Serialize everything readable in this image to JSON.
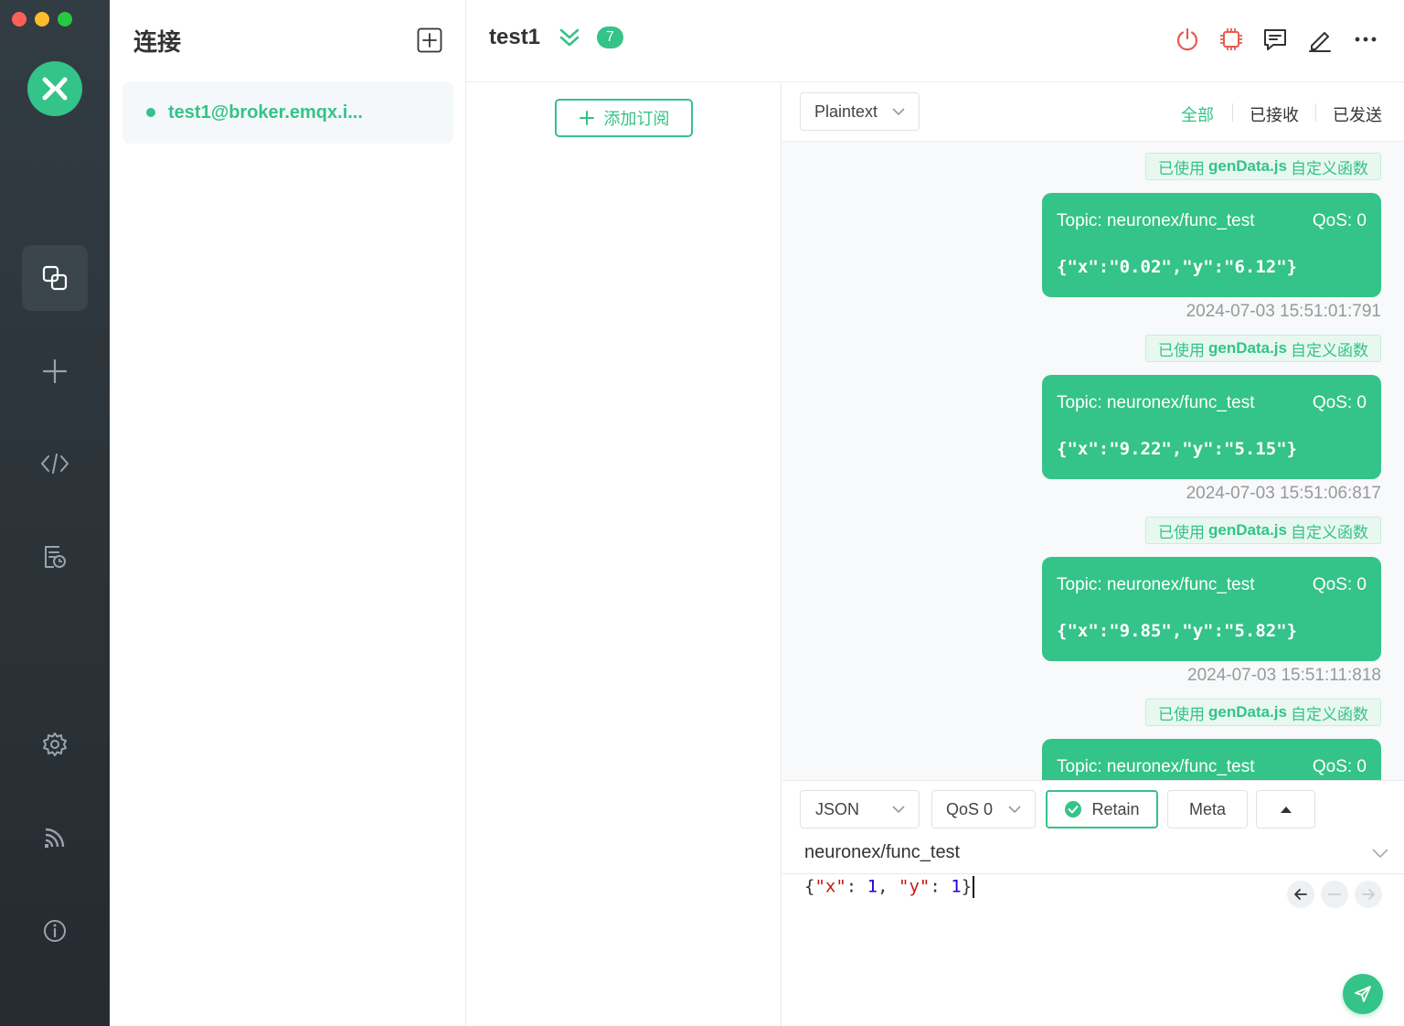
{
  "sidebar": {
    "nav": [
      "connections",
      "new-connection",
      "scripts",
      "logs",
      "settings",
      "subscriptions-feed",
      "about"
    ]
  },
  "connections": {
    "title": "连接",
    "items": [
      {
        "label": "test1@broker.emqx.i...",
        "status": "connected"
      }
    ]
  },
  "header": {
    "connection_name": "test1",
    "unread_count": "7"
  },
  "subscriptions": {
    "add_label": "添加订阅"
  },
  "messages": {
    "format": "Plaintext",
    "filters": [
      "全部",
      "已接收",
      "已发送"
    ],
    "items": [
      {
        "tag_prefix": "已使用",
        "tag_script": "genData.js",
        "tag_suffix": "自定义函数",
        "topic": "Topic: neuronex/func_test",
        "qos": "QoS: 0",
        "payload": "{\"x\":\"0.02\",\"y\":\"6.12\"}",
        "time": "2024-07-03 15:51:01:791"
      },
      {
        "tag_prefix": "已使用",
        "tag_script": "genData.js",
        "tag_suffix": "自定义函数",
        "topic": "Topic: neuronex/func_test",
        "qos": "QoS: 0",
        "payload": "{\"x\":\"9.22\",\"y\":\"5.15\"}",
        "time": "2024-07-03 15:51:06:817"
      },
      {
        "tag_prefix": "已使用",
        "tag_script": "genData.js",
        "tag_suffix": "自定义函数",
        "topic": "Topic: neuronex/func_test",
        "qos": "QoS: 0",
        "payload": "{\"x\":\"9.85\",\"y\":\"5.82\"}",
        "time": "2024-07-03 15:51:11:818"
      },
      {
        "tag_prefix": "已使用",
        "tag_script": "genData.js",
        "tag_suffix": "自定义函数",
        "topic": "Topic: neuronex/func_test",
        "qos": "QoS: 0",
        "payload": "",
        "time": ""
      }
    ]
  },
  "publish": {
    "format": "JSON",
    "qos": "QoS 0",
    "retain_label": "Retain",
    "retain_checked": true,
    "meta_label": "Meta",
    "topic": "neuronex/func_test",
    "payload_tokens": [
      "{",
      "\"x\"",
      ": ",
      "1",
      ", ",
      "\"y\"",
      ": ",
      "1",
      "}"
    ]
  },
  "colors": {
    "accent": "#34c388",
    "rail": "#2b3338",
    "danger": "#e85a4f"
  }
}
